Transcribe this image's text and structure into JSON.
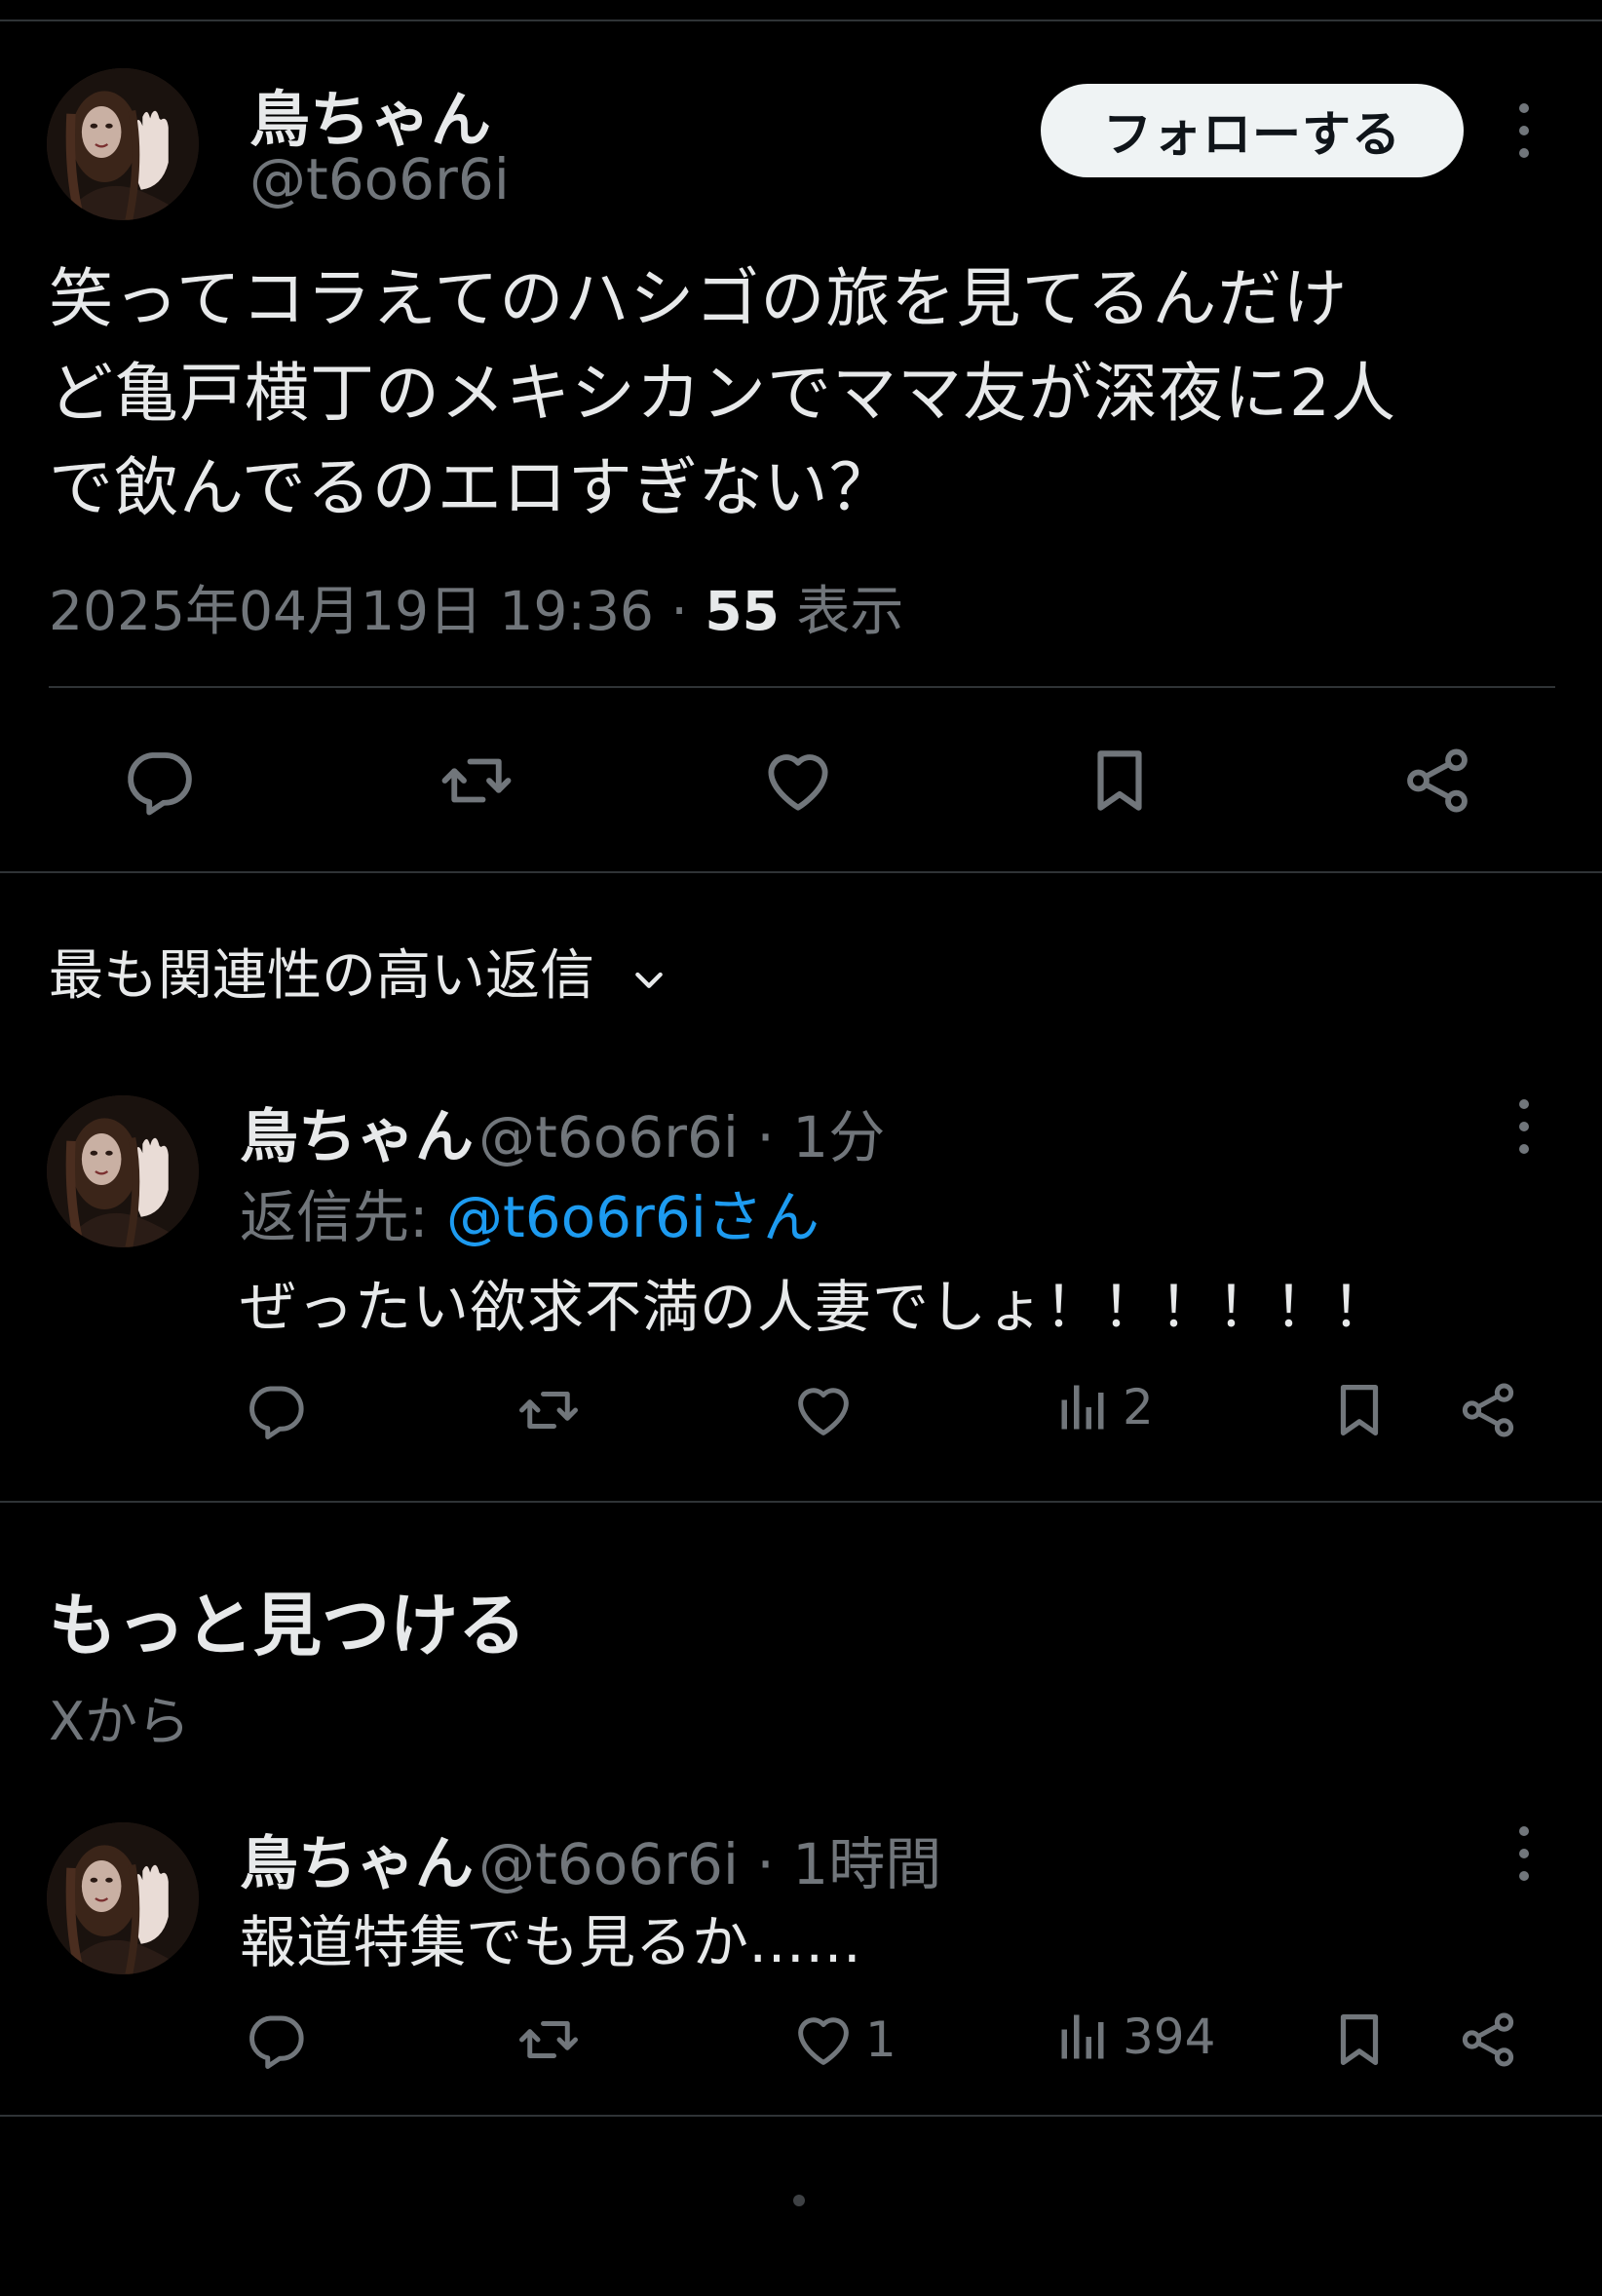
{
  "main_tweet": {
    "display_name": "鳥ちゃん",
    "handle": "@t6o6r6i",
    "follow_label": "フォローする",
    "text_lines": [
      "笑ってコラえてのハシゴの旅を見てるんだけ",
      "ど亀戸横丁のメキシカンでママ友が深夜に2人",
      "で飲んでるのエロすぎない？"
    ],
    "timestamp": "2025年04月19日 19:36",
    "separator": " · ",
    "views_count": "55",
    "views_label": " 表示"
  },
  "replies_section": {
    "sort_label": "最も関連性の高い返信"
  },
  "reply": {
    "display_name": "鳥ちゃん",
    "handle": "@t6o6r6i",
    "time": "1分",
    "replying_to_prefix": "返信先: ",
    "replying_to_handle": "@t6o6r6iさん",
    "text": "ぜったい欲求不満の人妻でしょ！！！！！！",
    "views_count": "2"
  },
  "discover": {
    "title": "もっと見つける",
    "subtitle": "Xから"
  },
  "discover_tweet": {
    "display_name": "鳥ちゃん",
    "handle": "@t6o6r6i",
    "time": "1時間",
    "text": "報道特集でも見るか……",
    "likes_count": "1",
    "views_count": "394"
  },
  "icons": {
    "reply": "reply-icon",
    "repost": "repost-icon",
    "like": "heart-icon",
    "bookmark": "bookmark-icon",
    "share": "share-icon",
    "views": "views-icon",
    "more": "more-icon",
    "chevron": "chevron-down-icon"
  },
  "colors": {
    "background": "#000000",
    "text": "#e7e9ea",
    "muted": "#71767b",
    "link": "#1d9bf0",
    "follow_button_bg": "#eff3f4",
    "divider": "#2f3336"
  }
}
